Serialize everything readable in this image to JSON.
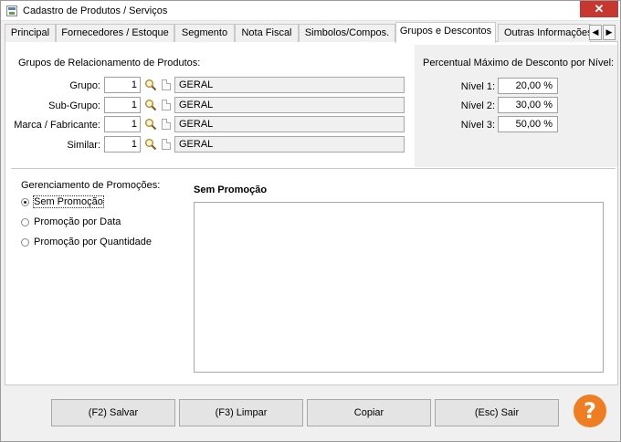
{
  "window": {
    "title": "Cadastro de Produtos / Serviços",
    "close_glyph": "✕"
  },
  "tabs": [
    {
      "label": "Principal"
    },
    {
      "label": "Fornecedores / Estoque"
    },
    {
      "label": "Segmento"
    },
    {
      "label": "Nota Fiscal"
    },
    {
      "label": "Simbolos/Compos."
    },
    {
      "label": "Grupos e Descontos"
    },
    {
      "label": "Outras Informações"
    }
  ],
  "active_tab": "Grupos e Descontos",
  "tab_scroll": {
    "left": "◀",
    "right": "▶"
  },
  "groups": {
    "heading": "Grupos de Relacionamento de Produtos:",
    "rows": [
      {
        "label": "Grupo:",
        "code": "1",
        "description": "GERAL"
      },
      {
        "label": "Sub-Grupo:",
        "code": "1",
        "description": "GERAL"
      },
      {
        "label": "Marca / Fabricante:",
        "code": "1",
        "description": "GERAL"
      },
      {
        "label": "Similar:",
        "code": "1",
        "description": "GERAL"
      }
    ]
  },
  "discount": {
    "heading": "Percentual Máximo de Desconto por Nível:",
    "levels": [
      {
        "label": "Nível 1:",
        "value": "20,00 %"
      },
      {
        "label": "Nível 2:",
        "value": "30,00 %"
      },
      {
        "label": "Nível 3:",
        "value": "50,00 %"
      }
    ]
  },
  "promotions": {
    "heading": "Gerenciamento de Promoções:",
    "options": [
      {
        "label": "Sem Promoção",
        "checked": true
      },
      {
        "label": "Promoção por Data",
        "checked": false
      },
      {
        "label": "Promoção por Quantidade",
        "checked": false
      }
    ],
    "panel_title": "Sem Promoção"
  },
  "buttons": {
    "save": "(F2) Salvar",
    "clear": "(F3) Limpar",
    "copy": "Copiar",
    "exit": "(Esc) Sair",
    "help": "?"
  },
  "colors": {
    "close": "#c7372f",
    "help": "#ef7d22"
  }
}
